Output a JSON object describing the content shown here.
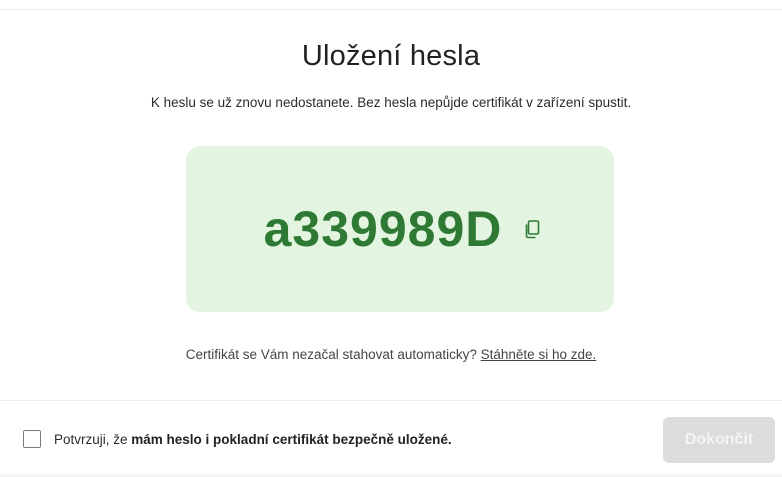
{
  "dialog": {
    "title": "Uložení hesla",
    "subtitle": "K heslu se už znovu nedostanete. Bez hesla nepůjde certifikát v zařízení spustit.",
    "password": "a339989D",
    "copy_icon": "copy-icon",
    "note_text": "Certifikát se Vám nezačal stahovat automaticky? ",
    "note_link": "Stáhněte si ho zde."
  },
  "footer": {
    "confirm_prefix": "Potvrzuji, že ",
    "confirm_bold": "mám heslo i pokladní certifikát bezpečně uložené",
    "confirm_suffix": ".",
    "checkbox_checked": false,
    "finish_label": "Dokončit",
    "finish_enabled": false
  },
  "colors": {
    "password_bg": "#e3f4e0",
    "password_text": "#2e7a34",
    "button_disabled_bg": "#dcdcdc"
  }
}
